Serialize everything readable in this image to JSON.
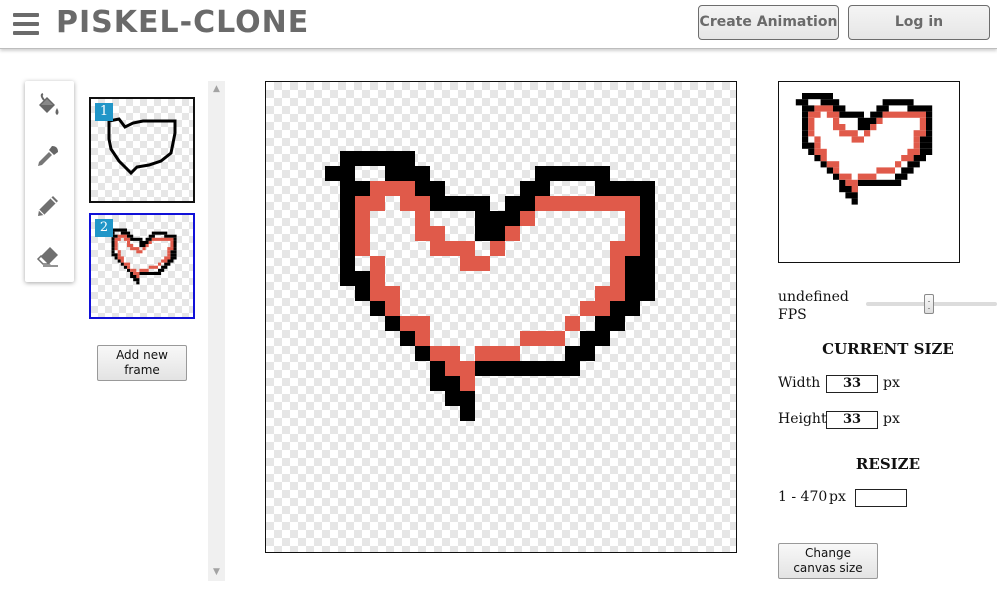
{
  "header": {
    "logo": "PISKEL-CLONE",
    "create_animation_label": "Create Animation",
    "login_label": "Log in"
  },
  "tools": [
    {
      "name": "paint-bucket-icon"
    },
    {
      "name": "eyedropper-icon"
    },
    {
      "name": "pencil-icon"
    },
    {
      "name": "eraser-icon"
    }
  ],
  "frames": [
    {
      "number": "1",
      "selected": false
    },
    {
      "number": "2",
      "selected": true
    }
  ],
  "add_frame_label": [
    "Add new",
    "frame"
  ],
  "canvas": {
    "grid_cols": 33,
    "grid_rows": 33
  },
  "fps": {
    "label": [
      "undefined",
      "FPS"
    ],
    "value_fraction": 0.48
  },
  "current_size": {
    "title": "CURRENT SIZE",
    "width_label": "Width",
    "width_value": "33",
    "width_unit": "px",
    "height_label": "Height",
    "height_value": "33",
    "height_unit": "px"
  },
  "resize": {
    "title": "RESIZE",
    "range_label": "1 - 470",
    "unit": "px",
    "value": ""
  },
  "change_canvas_label": [
    "Change",
    "canvas size"
  ],
  "colors": {
    "outline": "#000000",
    "fill": "#e05a4a",
    "frame_selected_border": "#1010d8",
    "frame_badge": "#2196c8"
  }
}
